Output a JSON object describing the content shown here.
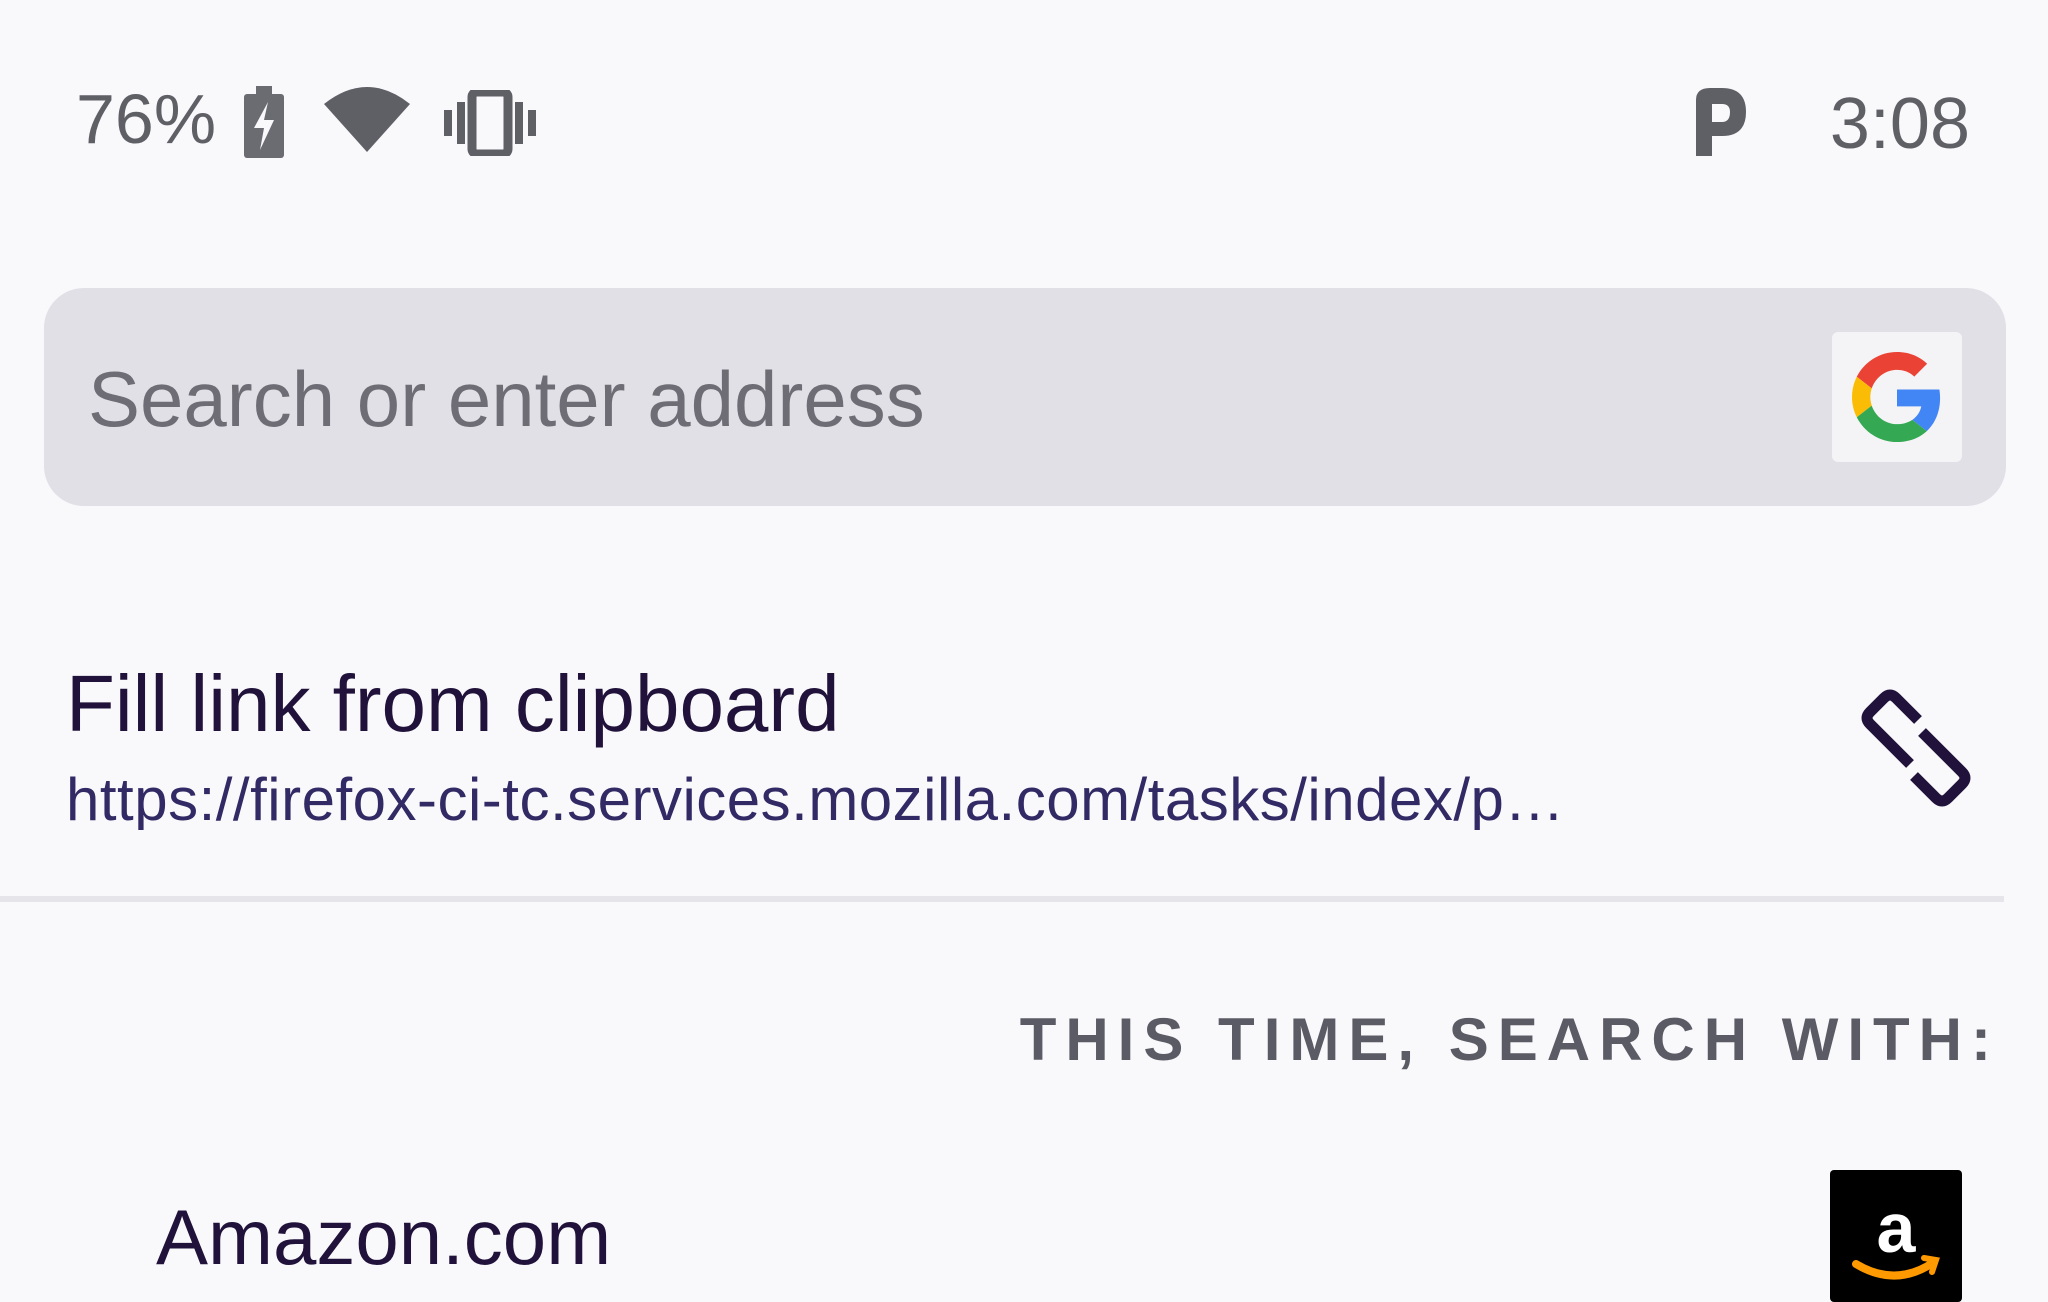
{
  "status_bar": {
    "battery_percent": "76%",
    "time": "3:08",
    "icons": [
      "battery-charging-icon",
      "wifi-icon",
      "vibrate-icon",
      "parking-p-icon"
    ]
  },
  "toolbar": {
    "search_placeholder": "Search or enter address",
    "engine_icon": "google-icon"
  },
  "clipboard_suggestion": {
    "title": "Fill link from clipboard",
    "url": "https://firefox-ci-tc.services.mozilla.com/tasks/index/p…",
    "icon": "link-icon"
  },
  "search_engines": {
    "header": "THIS TIME, SEARCH WITH:",
    "items": [
      {
        "name": "Amazon.com",
        "icon": "amazon-icon"
      }
    ]
  },
  "colors": {
    "background": "#f9f9fb",
    "url_bar": "#e1e0e6",
    "primary_text": "#20123a",
    "url_text": "#312a65",
    "secondary_text": "#5b5b66"
  }
}
